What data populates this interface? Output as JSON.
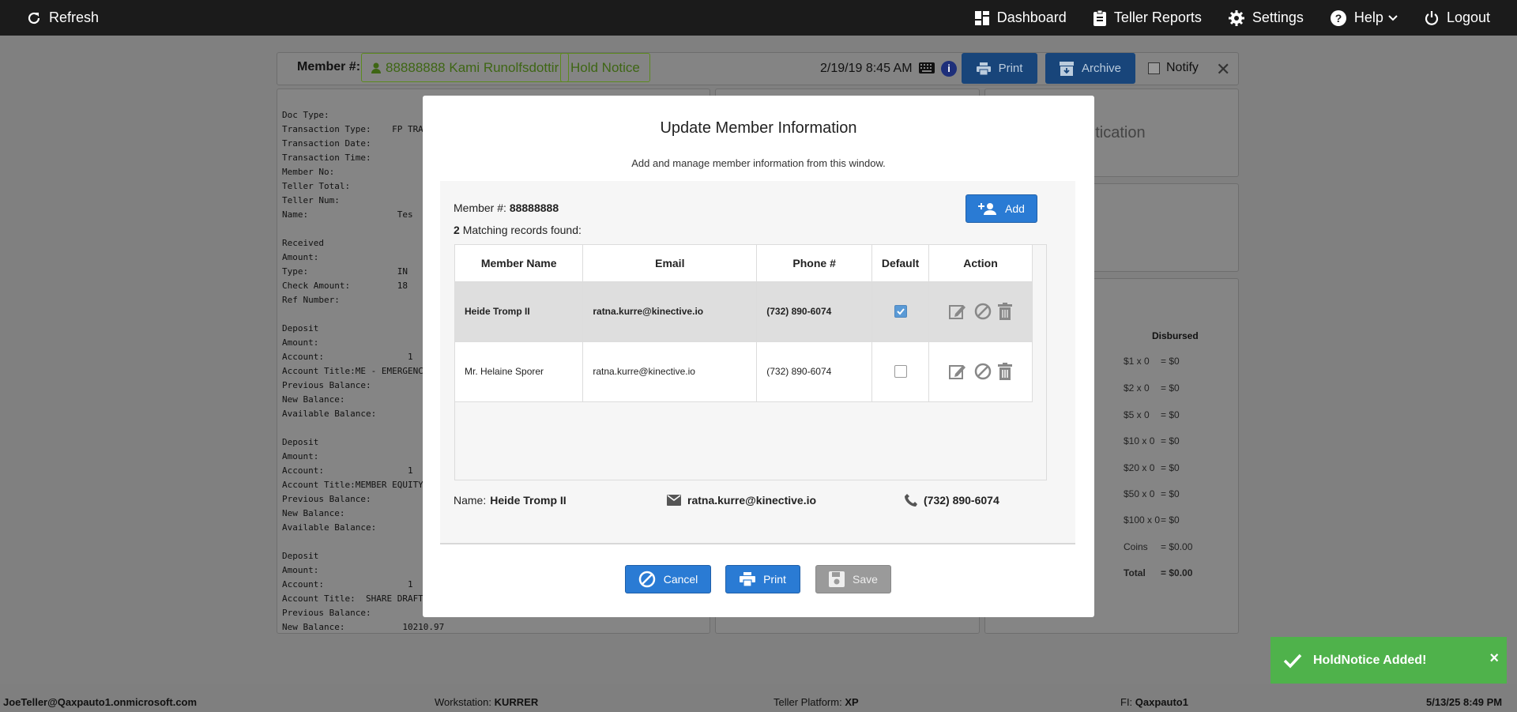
{
  "topbar": {
    "refresh_label": "Refresh",
    "dashboard_label": "Dashboard",
    "teller_reports_label": "Teller Reports",
    "settings_label": "Settings",
    "help_label": "Help",
    "logout_label": "Logout"
  },
  "member_bar": {
    "label": "Member #:",
    "member": "88888888 Kami Runolfsdottir",
    "hold_notice": "Hold Notice",
    "datetime": "2/19/19 8:45 AM",
    "info": "i",
    "print_label": "Print",
    "archive_label": "Archive",
    "notify_label": "Notify",
    "close_label": "✕"
  },
  "receipt_lines": "Doc Type:\nTransaction Type:    FP TRA\nTransaction Date:\nTransaction Time:\nMember No:\nTeller Total:\nTeller Num:\nName:                 Tes\n\nReceived\nAmount:\nType:                 IN\nCheck Amount:         18\nRef Number:\n\nDeposit\nAmount:\nAccount:                1\nAccount Title:ME - EMERGENC\nPrevious Balance:\nNew Balance:\nAvailable Balance:\n\nDeposit\nAmount:\nAccount:                1\nAccount Title:MEMBER EQUITY\nPrevious Balance:\nNew Balance:\nAvailable Balance:\n\nDeposit\nAmount:\nAccount:                1\nAccount Title:  SHARE DRAFT\nPrevious Balance:\nNew Balance:           10210.97",
  "auth_text": "entication",
  "cash": {
    "header": "Disbursed",
    "rows": [
      {
        "denom": "$1 x 0",
        "value": "= $0"
      },
      {
        "denom": "$2 x 0",
        "value": "= $0"
      },
      {
        "denom": "$5 x 0",
        "value": "= $0"
      },
      {
        "denom": "$10 x 0",
        "value": "= $0"
      },
      {
        "denom": "$20 x 0",
        "value": "= $0"
      },
      {
        "denom": "$50 x 0",
        "value": "= $0"
      },
      {
        "denom": "$100 x 0",
        "value": "= $0"
      },
      {
        "denom": "Coins",
        "value": "= $0.00"
      },
      {
        "denom": "Total",
        "value": "= $0.00"
      }
    ]
  },
  "modal": {
    "title": "Update Member Information",
    "subtitle": "Add and manage member information from this window.",
    "member_label": "Member #:",
    "member_number": "88888888",
    "match_count": "2",
    "match_text": "Matching records found:",
    "add_label": "Add",
    "columns": [
      "Member Name",
      "Email",
      "Phone #",
      "Default",
      "Action"
    ],
    "rows": [
      {
        "name": "Heide Tromp II",
        "email": "ratna.kurre@kinective.io",
        "phone": "(732) 890-6074",
        "default": true
      },
      {
        "name": "Mr. Helaine Sporer",
        "email": "ratna.kurre@kinective.io",
        "phone": "(732) 890-6074",
        "default": false
      }
    ],
    "detail": {
      "name_label": "Name:",
      "name": "Heide Tromp II",
      "email": "ratna.kurre@kinective.io",
      "phone": "(732) 890-6074"
    },
    "cancel_label": "Cancel",
    "print_label": "Print",
    "save_label": "Save"
  },
  "toast": {
    "message": "HoldNotice Added!",
    "close": "×"
  },
  "statusbar": {
    "user": "JoeTeller@Qaxpauto1.onmicrosoft.com",
    "workstation_label": "Workstation:",
    "workstation": "KURRER",
    "platform_label": "Teller Platform:",
    "platform": "XP",
    "fi_label": "FI:",
    "fi": "Qaxpauto1",
    "datetime": "5/13/25 8:49 PM"
  }
}
